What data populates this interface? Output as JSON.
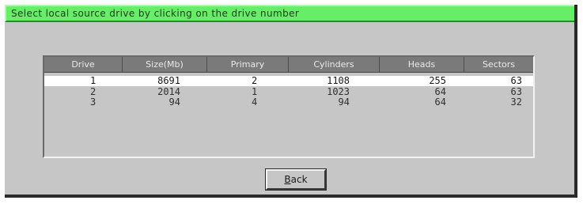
{
  "dialog": {
    "title": "Select local source drive by clicking on the drive number",
    "accent_color": "#66ee66"
  },
  "table": {
    "columns": [
      "Drive",
      "Size(Mb)",
      "Primary",
      "Cylinders",
      "Heads",
      "Sectors"
    ],
    "rows": [
      {
        "drive": "1",
        "size": "8691",
        "primary": "2",
        "cylinders": "1108",
        "heads": "255",
        "sectors": "63",
        "selected": true
      },
      {
        "drive": "2",
        "size": "2014",
        "primary": "1",
        "cylinders": "1023",
        "heads": "64",
        "sectors": "63",
        "selected": false
      },
      {
        "drive": "3",
        "size": "94",
        "primary": "4",
        "cylinders": "94",
        "heads": "64",
        "sectors": "32",
        "selected": false
      }
    ]
  },
  "buttons": {
    "back_label": "Back"
  }
}
